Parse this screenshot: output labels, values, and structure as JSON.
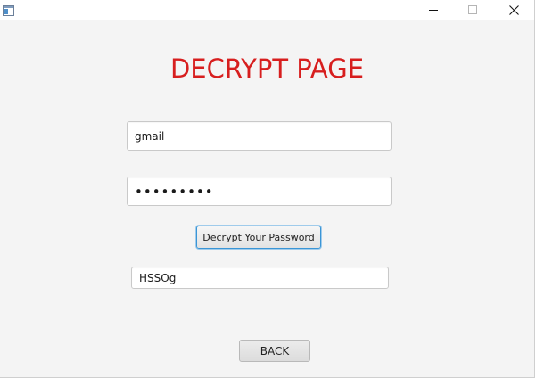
{
  "window": {
    "minimize_icon": "minimize-icon",
    "maximize_icon": "maximize-icon",
    "close_icon": "close-icon",
    "app_icon": "java-app-icon"
  },
  "page": {
    "title": "DECRYPT PAGE",
    "title_color": "#d71e1e"
  },
  "form": {
    "username_value": "gmail",
    "password_value": "•••••••••",
    "decrypt_button_label": "Decrypt Your Password",
    "result_value": "HSSOg",
    "back_button_label": "BACK"
  },
  "colors": {
    "background": "#f4f4f4",
    "focus_border": "#3a95d6"
  }
}
